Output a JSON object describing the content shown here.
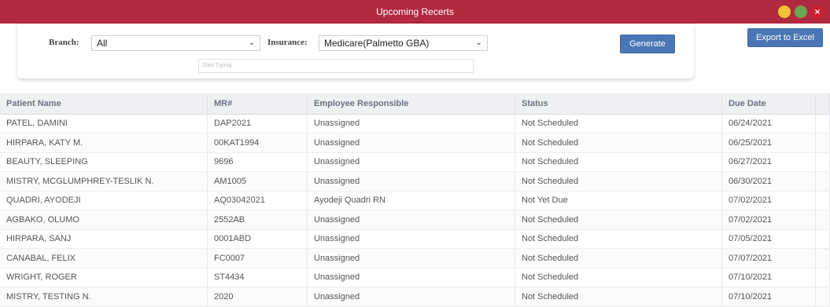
{
  "window": {
    "title": "Upcoming Recerts"
  },
  "filters": {
    "branch_label": "Branch:",
    "branch_value": "All",
    "insurance_label": "Insurance:",
    "insurance_value": "Medicare(Palmetto GBA)",
    "search_placeholder": "Start Typing",
    "generate_label": "Generate",
    "export_label": "Export to Excel"
  },
  "table": {
    "headers": [
      "Patient Name",
      "MR#",
      "Employee Responsible",
      "Status",
      "Due Date"
    ],
    "rows": [
      [
        "PATEL, DAMINI",
        "DAP2021",
        "Unassigned",
        "Not Scheduled",
        "06/24/2021"
      ],
      [
        "HIRPARA, KATY M.",
        "00KAT1994",
        "Unassigned",
        "Not Scheduled",
        "06/25/2021"
      ],
      [
        "BEAUTY, SLEEPING",
        "9696",
        "Unassigned",
        "Not Scheduled",
        "06/27/2021"
      ],
      [
        "MISTRY, MCGLUMPHREY-TESLIK N.",
        "AM1005",
        "Unassigned",
        "Not Scheduled",
        "06/30/2021"
      ],
      [
        "QUADRI, AYODEJI",
        "AQ03042021",
        "Ayodeji Quadri RN",
        "Not Yet Due",
        "07/02/2021"
      ],
      [
        "AGBAKO, OLUMO",
        "2552AB",
        "Unassigned",
        "Not Scheduled",
        "07/02/2021"
      ],
      [
        "HIRPARA, SANJ",
        "0001ABD",
        "Unassigned",
        "Not Scheduled",
        "07/05/2021"
      ],
      [
        "CANABAL, FELIX",
        "FC0007",
        "Unassigned",
        "Not Scheduled",
        "07/07/2021"
      ],
      [
        "WRIGHT, ROGER",
        "ST4434",
        "Unassigned",
        "Not Scheduled",
        "07/10/2021"
      ],
      [
        "MISTRY, TESTING N.",
        "2020",
        "Unassigned",
        "Not Scheduled",
        "07/10/2021"
      ]
    ]
  },
  "icons": {
    "minimize": "minimize-icon",
    "maximize": "maximize-icon",
    "close": "close-icon",
    "close_glyph": "×",
    "chevron_glyph": "⌄"
  },
  "colors": {
    "titlebar": "#b22a3f",
    "button": "#4a76b5"
  }
}
